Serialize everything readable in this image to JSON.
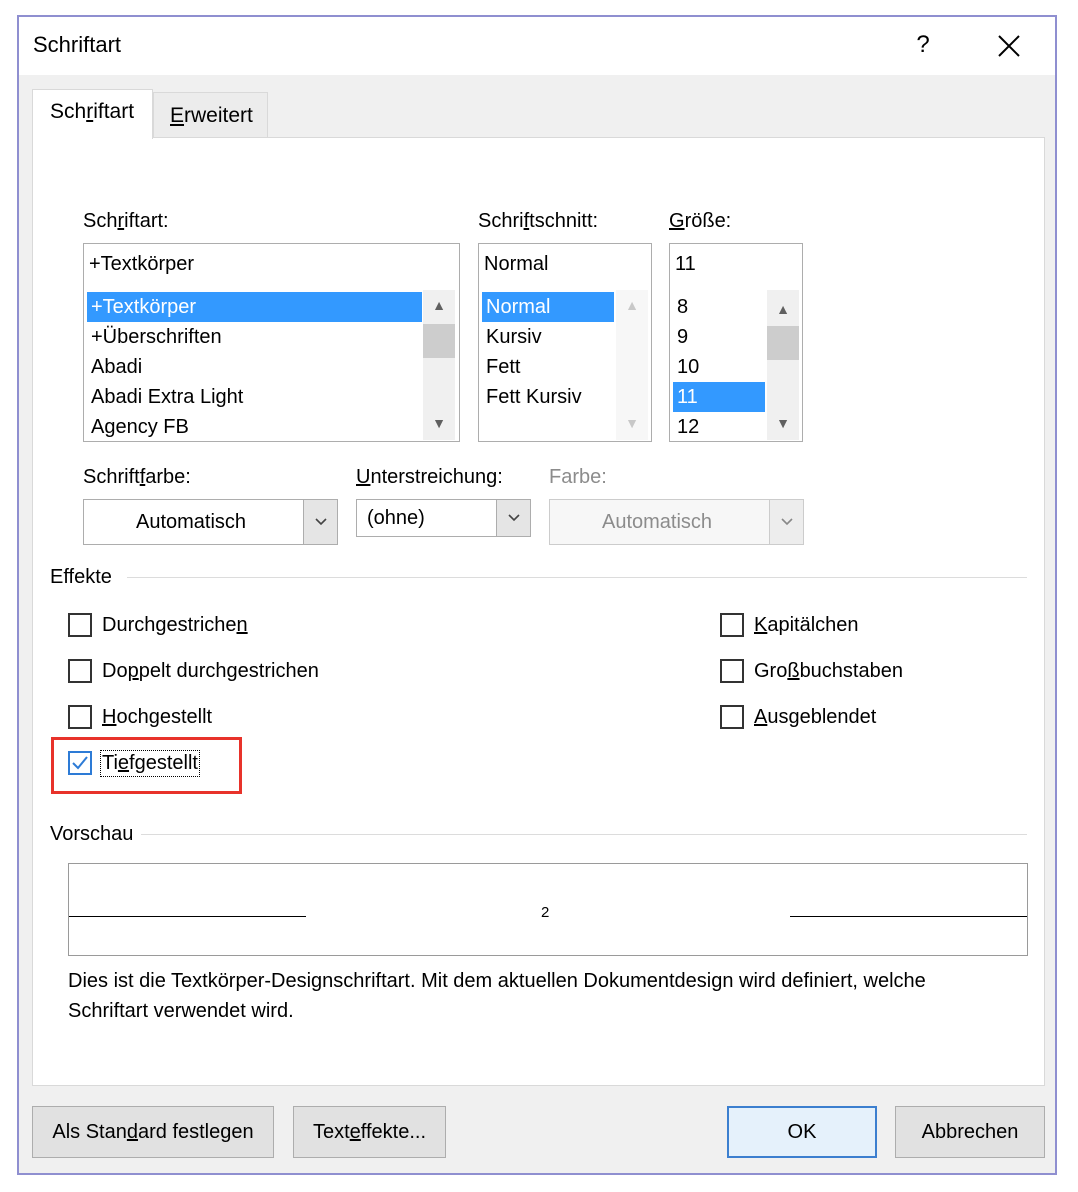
{
  "window": {
    "title": "Schriftart",
    "help_label": "?"
  },
  "tabs": [
    {
      "pre": "Sch",
      "u": "r",
      "post": "iftart"
    },
    {
      "pre": "",
      "u": "E",
      "post": "rweitert"
    }
  ],
  "font": {
    "label": {
      "pre": "Sch",
      "u": "r",
      "post": "iftart:"
    },
    "value": "+Textkörper",
    "items": [
      "+Textkörper",
      "+Überschriften",
      "Abadi",
      "Abadi Extra Light",
      "Agency FB"
    ]
  },
  "style": {
    "label": {
      "pre": "Schri",
      "u": "f",
      "post": "tschnitt:"
    },
    "value": "Normal",
    "items": [
      "Normal",
      "Kursiv",
      "Fett",
      "Fett Kursiv"
    ]
  },
  "size": {
    "label": {
      "pre": "",
      "u": "G",
      "post": "röße:"
    },
    "value": "11",
    "items": [
      "8",
      "9",
      "10",
      "11",
      "12"
    ]
  },
  "font_color": {
    "label": {
      "pre": "Schrift",
      "u": "f",
      "post": "arbe:"
    },
    "value": "Automatisch"
  },
  "underline": {
    "label": {
      "pre": "",
      "u": "U",
      "post": "nterstreichung:"
    },
    "value": "(ohne)"
  },
  "underline_color": {
    "label": "Farbe:",
    "value": "Automatisch"
  },
  "effects": {
    "heading": "Effekte",
    "left": [
      {
        "pre": "Durchgestriche",
        "u": "n",
        "post": "",
        "checked": false
      },
      {
        "pre": "Do",
        "u": "p",
        "post": "pelt durchgestrichen",
        "checked": false
      },
      {
        "pre": "",
        "u": "H",
        "post": "ochgestellt",
        "checked": false
      },
      {
        "pre": "Ti",
        "u": "e",
        "post": "fgestellt",
        "checked": true
      }
    ],
    "right": [
      {
        "pre": "",
        "u": "K",
        "post": "apitälchen",
        "checked": false
      },
      {
        "pre": "Gro",
        "u": "ß",
        "post": "buchstaben",
        "checked": false
      },
      {
        "pre": "",
        "u": "A",
        "post": "usgeblendet",
        "checked": false
      }
    ]
  },
  "preview": {
    "heading": "Vorschau",
    "sample": "2",
    "description": "Dies ist die Textkörper-Designschriftart. Mit dem aktuellen Dokumentdesign wird definiert, welche Schriftart verwendet wird."
  },
  "buttons": {
    "set_default": {
      "pre": "Als Stan",
      "u": "d",
      "post": "ard festlegen"
    },
    "text_effects": {
      "pre": "Text",
      "u": "e",
      "post": "ffekte..."
    },
    "ok": "OK",
    "cancel": "Abbrechen"
  },
  "colors": {
    "selection": "#3399ff",
    "highlight_box": "#e8322a",
    "default_button_border": "#3c7fcf"
  }
}
